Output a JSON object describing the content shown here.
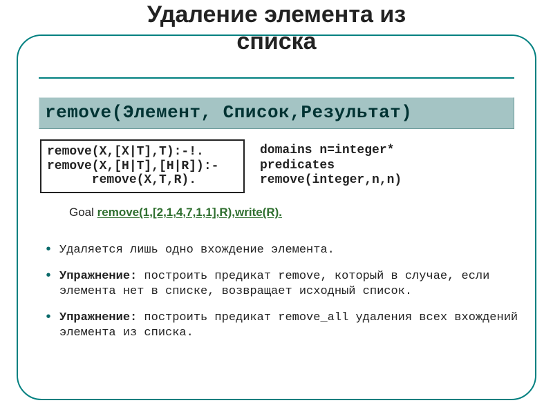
{
  "title_line1": "Удаление элемента из",
  "title_line2": "списка",
  "signature": "remove(Элемент, Список,Результат)",
  "code": {
    "line1": "remove(X,[X|T],T):-!.",
    "line2": "remove(X,[H|T],[H|R]):-",
    "line3": "      remove(X,T,R)."
  },
  "domains": {
    "line1": "domains n=integer*",
    "line2": "predicates",
    "line3": "remove(integer,n,n)"
  },
  "goal": {
    "label": "Goal ",
    "code": "remove(1,[2,1,4,7,1,1],R),write(R)."
  },
  "bullets": {
    "b1": "Удаляется лишь одно вхождение элемента.",
    "b2_label": "Упражнение:",
    "b2_text": " построить предикат remove, который в случае, если элемента нет в списке, возвращает исходный список.",
    "b3_label": "Упражнение:",
    "b3_text": " построить предикат remove_all удаления всех вхождений элемента из списка."
  }
}
